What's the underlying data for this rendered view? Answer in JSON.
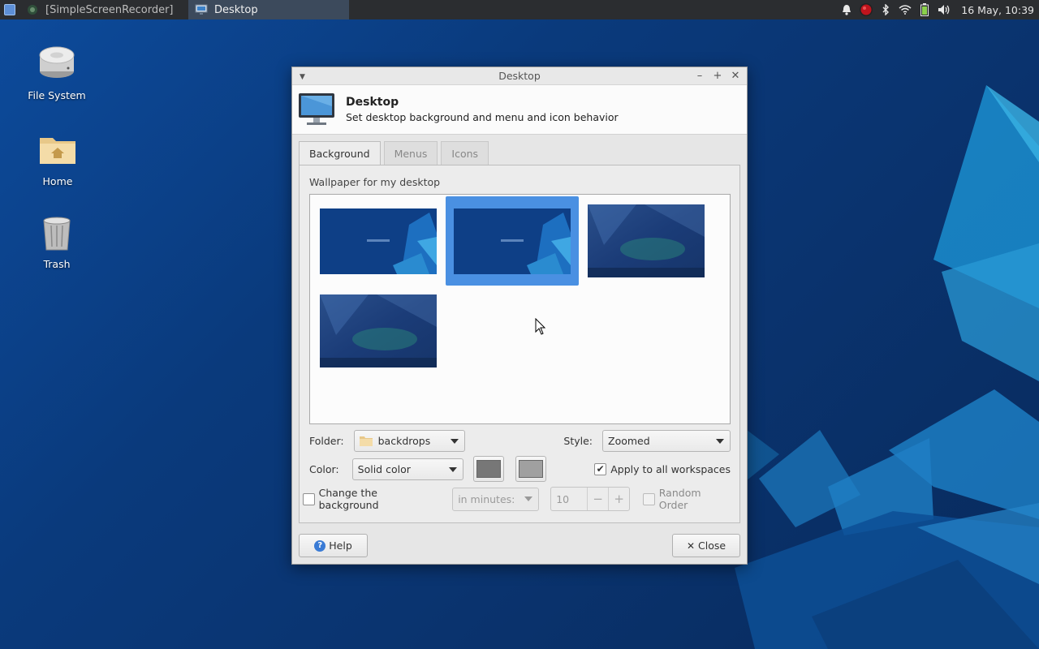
{
  "panel": {
    "tasks": [
      {
        "label": "[SimpleScreenRecorder]",
        "icon": "screen-recorder-icon"
      },
      {
        "label": "Desktop",
        "icon": "monitor-icon"
      }
    ],
    "clock": "16 May, 10:39"
  },
  "desktop_icons": [
    {
      "label": "File System",
      "icon": "drive-icon"
    },
    {
      "label": "Home",
      "icon": "home-folder-icon"
    },
    {
      "label": "Trash",
      "icon": "trash-icon"
    }
  ],
  "window": {
    "title": "Desktop",
    "header_title": "Desktop",
    "header_subtitle": "Set desktop background and menu and icon behavior",
    "tabs": [
      "Background",
      "Menus",
      "Icons"
    ],
    "wallpaper_label": "Wallpaper for my desktop",
    "folder_label": "Folder:",
    "folder_value": "backdrops",
    "style_label": "Style:",
    "style_value": "Zoomed",
    "color_label": "Color:",
    "color_value": "Solid color",
    "color1": "#777777",
    "color2": "#a0a0a0",
    "apply_all": "Apply to all workspaces",
    "change_background": "Change the background",
    "interval_unit": "in minutes:",
    "interval_value": "10",
    "random_order": "Random Order",
    "help_label": "Help",
    "close_label": "Close"
  },
  "colors": {
    "accent": "#4a90e2",
    "panel_bg": "#2b2d30",
    "selected_task": "#3c4a5c"
  }
}
